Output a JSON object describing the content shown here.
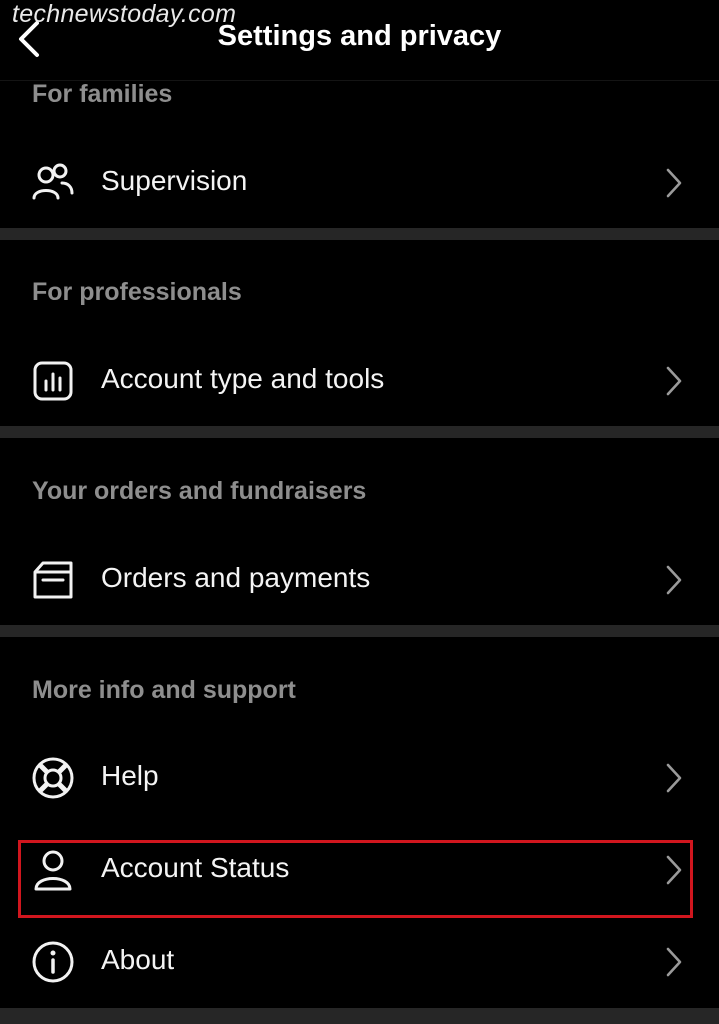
{
  "watermark": "technewstoday.com",
  "header": {
    "title": "Settings and privacy"
  },
  "sections": [
    {
      "title": "For families",
      "items": [
        {
          "label": "Supervision",
          "icon": "supervision-icon"
        }
      ]
    },
    {
      "title": "For professionals",
      "items": [
        {
          "label": "Account type and tools",
          "icon": "chart-icon"
        }
      ]
    },
    {
      "title": "Your orders and fundraisers",
      "items": [
        {
          "label": "Orders and payments",
          "icon": "orders-icon"
        }
      ]
    },
    {
      "title": "More info and support",
      "items": [
        {
          "label": "Help",
          "icon": "lifebuoy-icon"
        },
        {
          "label": "Account Status",
          "icon": "person-icon"
        },
        {
          "label": "About",
          "icon": "info-icon"
        }
      ]
    }
  ],
  "colors": {
    "background": "#000000",
    "divider": "#262626",
    "section_title": "#8e8e8e",
    "highlight": "#d0161e"
  }
}
